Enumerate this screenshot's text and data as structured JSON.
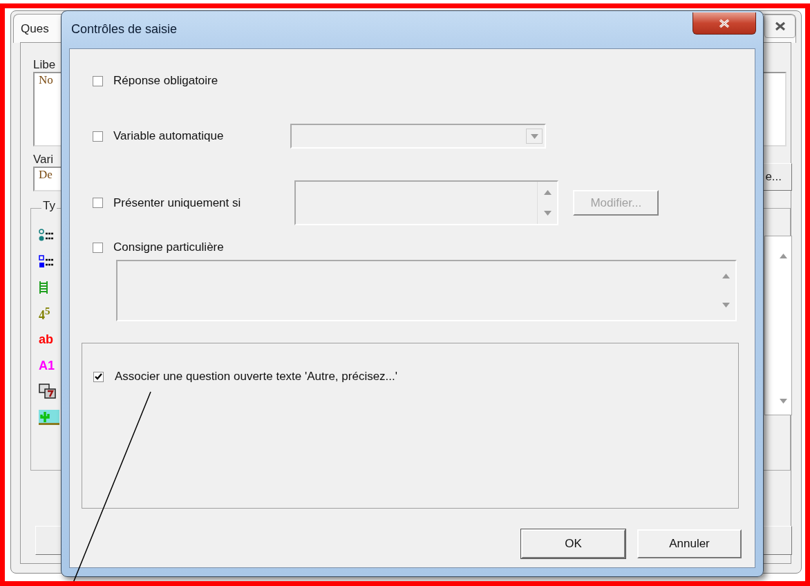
{
  "background_window": {
    "tab_title": "Ques",
    "label_field": {
      "label": "Libe",
      "value": "No"
    },
    "variable_field": {
      "label": "Vari",
      "value": "De"
    },
    "type_group": {
      "label": "Ty",
      "items": [
        {
          "kind": "radio-list"
        },
        {
          "kind": "check-list"
        },
        {
          "kind": "grid"
        },
        {
          "kind": "number",
          "label": "4$^{5}$"
        },
        {
          "kind": "text",
          "label": "ab"
        },
        {
          "kind": "alnum",
          "label": "A1"
        },
        {
          "kind": "dice"
        },
        {
          "kind": "picture"
        }
      ]
    },
    "side_button": "e..."
  },
  "dialog": {
    "title": "Contrôles de saisie",
    "options": [
      {
        "kind": "plain",
        "label": "Réponse obligatoire",
        "checked": false
      },
      {
        "kind": "combo",
        "label": "Variable automatique",
        "checked": false
      },
      {
        "kind": "condition",
        "label": "Présenter uniquement si",
        "checked": false,
        "button": {
          "label": "Modifier...",
          "disabled": true
        }
      },
      {
        "kind": "memo",
        "label": "Consigne particulière",
        "checked": false
      }
    ],
    "group_option": {
      "label": "Associer une question ouverte texte 'Autre, précisez...'",
      "checked": true
    },
    "buttons": [
      "OK",
      "Annuler"
    ]
  }
}
